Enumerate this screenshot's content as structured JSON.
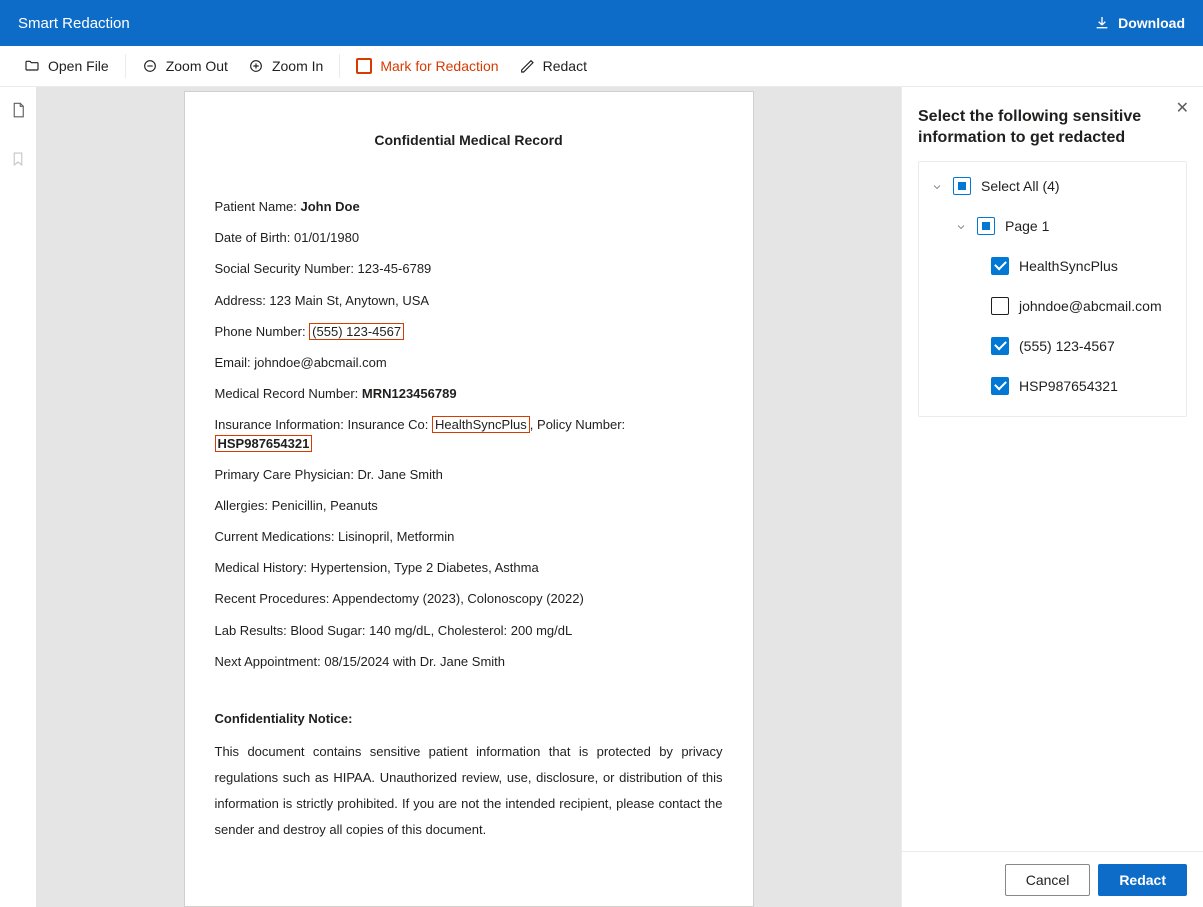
{
  "header": {
    "title": "Smart Redaction",
    "download": "Download"
  },
  "toolbar": {
    "open": "Open File",
    "zoom_out": "Zoom Out",
    "zoom_in": "Zoom In",
    "mark": "Mark for Redaction",
    "redact": "Redact"
  },
  "document": {
    "title": "Confidential Medical Record",
    "lines": {
      "patient_label": "Patient Name: ",
      "patient_value": "John Doe",
      "dob": "Date of Birth: 01/01/1980",
      "ssn": "Social Security Number: 123-45-6789",
      "address": "Address: 123 Main St, Anytown, USA",
      "phone_label": "Phone Number: ",
      "phone_value": "(555) 123-4567",
      "email": "Email: johndoe@abcmail.com",
      "mrn_label": "Medical Record Number: ",
      "mrn_value": "MRN123456789",
      "ins_prefix": "Insurance Information: Insurance Co: ",
      "ins_co": "HealthSyncPlus",
      "ins_mid": ", Policy Number: ",
      "ins_policy": "HSP987654321",
      "pcp": "Primary Care Physician: Dr. Jane Smith",
      "allergies": "Allergies: Penicillin, Peanuts",
      "meds": "Current Medications: Lisinopril, Metformin",
      "history": "Medical History: Hypertension, Type 2 Diabetes, Asthma",
      "procedures": "Recent Procedures: Appendectomy (2023), Colonoscopy (2022)",
      "labs": "Lab Results: Blood Sugar: 140 mg/dL, Cholesterol: 200 mg/dL",
      "appt": "Next Appointment: 08/15/2024 with Dr. Jane Smith"
    },
    "notice_heading": "Confidentiality Notice:",
    "notice_body": "This document contains sensitive patient information that is protected by privacy regulations such as HIPAA. Unauthorized review, use, disclosure, or distribution of this information is strictly prohibited. If you are not the intended recipient, please contact the sender and destroy all copies of this document."
  },
  "panel": {
    "title": "Select the following sensitive information to get redacted",
    "select_all": "Select All (4)",
    "page_label": "Page 1",
    "items": [
      {
        "label": "HealthSyncPlus",
        "checked": true
      },
      {
        "label": "johndoe@abcmail.com",
        "checked": false
      },
      {
        "label": "(555) 123-4567",
        "checked": true
      },
      {
        "label": "HSP987654321",
        "checked": true
      }
    ],
    "cancel": "Cancel",
    "redact": "Redact"
  }
}
